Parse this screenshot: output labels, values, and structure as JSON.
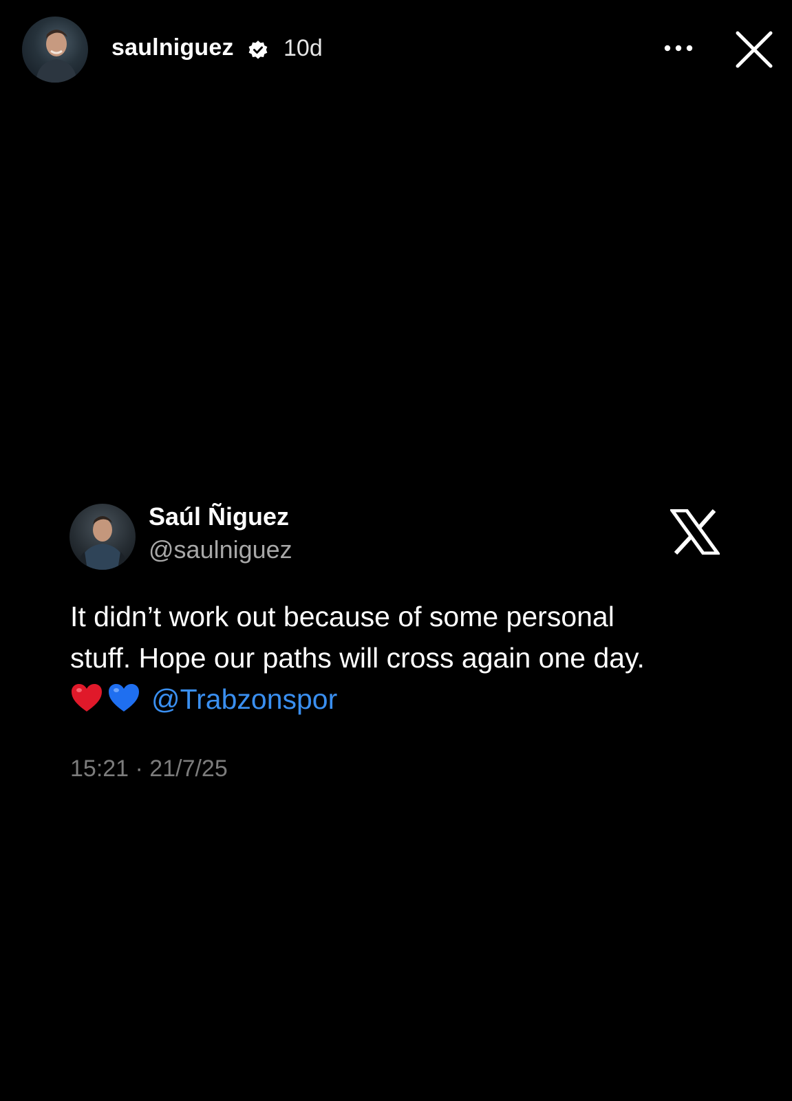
{
  "story": {
    "username": "saulniguez",
    "time_ago": "10d",
    "more_icon": "more-horizontal-icon",
    "close_icon": "close-icon",
    "verified_icon": "verified-badge-icon"
  },
  "tweet": {
    "display_name": "Saúl Ñiguez",
    "handle": "@saulniguez",
    "platform_icon": "x-logo-icon",
    "text_line_1": "It didn’t work out because of some personal",
    "text_line_2": "stuff. Hope our paths will cross again one day.",
    "emojis": [
      "red-heart",
      "blue-heart"
    ],
    "mention": "@Trabzonspor",
    "timestamp": "15:21 · 21/7/25"
  },
  "colors": {
    "background": "#000000",
    "text_primary": "#ffffff",
    "handle": "#a8a8a8",
    "timestamp": "#7c7c7c",
    "mention": "#3a8ff0",
    "heart_red": "#e0192a",
    "heart_blue": "#1f6ff0"
  }
}
